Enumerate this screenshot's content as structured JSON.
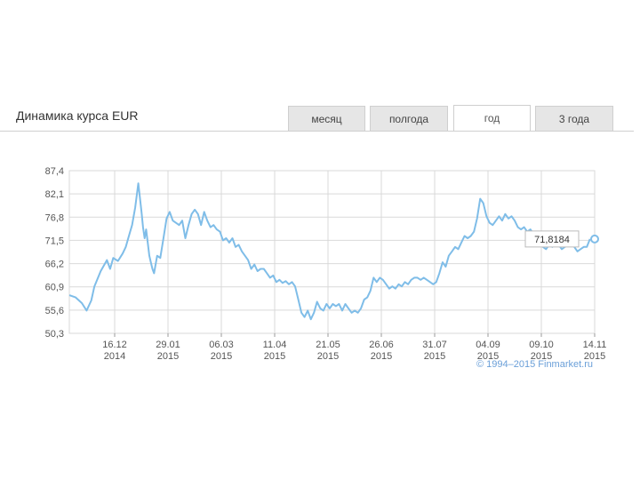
{
  "header": {
    "title": "Динамика курса EUR",
    "tabs": [
      {
        "label": "месяц",
        "active": false
      },
      {
        "label": "полгода",
        "active": false
      },
      {
        "label": "год",
        "active": true
      },
      {
        "label": "3 года",
        "active": false
      }
    ]
  },
  "copyright": "© 1994–2015 Finmarket.ru",
  "colors": {
    "line": "#7fbde8",
    "grid": "#d9d9d9",
    "axis_text": "#555555",
    "tooltip_border": "#bbbbbb"
  },
  "chart_data": {
    "type": "line",
    "title": "",
    "xlabel": "",
    "ylabel": "",
    "ylim": [
      50.3,
      87.4
    ],
    "y_ticks": [
      "87,4",
      "82,1",
      "76,8",
      "71,5",
      "66,2",
      "60,9",
      "55,6",
      "50,3"
    ],
    "x_ticks": [
      {
        "line1": "16.12",
        "line2": "2014"
      },
      {
        "line1": "29.01",
        "line2": "2015"
      },
      {
        "line1": "06.03",
        "line2": "2015"
      },
      {
        "line1": "11.04",
        "line2": "2015"
      },
      {
        "line1": "21.05",
        "line2": "2015"
      },
      {
        "line1": "26.06",
        "line2": "2015"
      },
      {
        "line1": "31.07",
        "line2": "2015"
      },
      {
        "line1": "04.09",
        "line2": "2015"
      },
      {
        "line1": "09.10",
        "line2": "2015"
      },
      {
        "line1": "14.11",
        "line2": "2015"
      }
    ],
    "grid": true,
    "x_range_days": [
      -46,
      289
    ],
    "series": [
      {
        "name": "",
        "x_days": [
          -46,
          -42,
          -38,
          -35,
          -32,
          -30,
          -26,
          -22,
          -20,
          -18,
          -15,
          -12,
          -10,
          -8,
          -6,
          -4,
          -2,
          0,
          1,
          2,
          3,
          4,
          5,
          6,
          7,
          8,
          10,
          12,
          14,
          16,
          18,
          20,
          22,
          24,
          26,
          28,
          30,
          32,
          34,
          36,
          38,
          40,
          42,
          44,
          46,
          48,
          50,
          52,
          54,
          56,
          58,
          60,
          62,
          64,
          66,
          68,
          70,
          72,
          74,
          76,
          78,
          80,
          82,
          84,
          86,
          88,
          90,
          92,
          94,
          96,
          98,
          100,
          102,
          104,
          106,
          108,
          110,
          112,
          114,
          116,
          118,
          120,
          122,
          124,
          126,
          128,
          130,
          132,
          134,
          136,
          138,
          140,
          142,
          144,
          146,
          148,
          150,
          152,
          154,
          156,
          158,
          160,
          162,
          164,
          166,
          168,
          170,
          172,
          174,
          176,
          178,
          180,
          182,
          184,
          186,
          188,
          190,
          192,
          194,
          196,
          198,
          200,
          202,
          204,
          206,
          208,
          210,
          212,
          214,
          216,
          218,
          220,
          222,
          224,
          226,
          228,
          230,
          232,
          234,
          236,
          238,
          240,
          242,
          244,
          246,
          248,
          250,
          252,
          254,
          256,
          258,
          260,
          262,
          264,
          266,
          268,
          270,
          272,
          274,
          276,
          278,
          280,
          282,
          284,
          286,
          288,
          289
        ],
        "values": [
          59.0,
          58.5,
          57.2,
          55.5,
          57.8,
          61.0,
          64.5,
          67.0,
          65.0,
          67.5,
          66.8,
          68.5,
          70.0,
          72.5,
          75.0,
          79.0,
          84.5,
          78.0,
          74.5,
          72.0,
          74.0,
          71.0,
          68.0,
          66.5,
          65.0,
          64.0,
          68.0,
          67.5,
          72.0,
          76.5,
          78.0,
          76.0,
          75.5,
          75.0,
          76.0,
          72.0,
          75.0,
          77.5,
          78.5,
          77.5,
          75.0,
          78.0,
          76.0,
          74.5,
          75.0,
          74.0,
          73.5,
          71.5,
          72.0,
          71.0,
          72.0,
          70.0,
          70.5,
          69.0,
          68.0,
          67.0,
          65.0,
          66.0,
          64.5,
          65.0,
          65.0,
          64.0,
          63.0,
          63.5,
          62.0,
          62.5,
          61.8,
          62.2,
          61.5,
          62.0,
          61.0,
          58.0,
          55.0,
          54.0,
          55.5,
          53.5,
          55.0,
          57.5,
          56.0,
          55.5,
          57.0,
          56.0,
          57.0,
          56.5,
          57.0,
          55.5,
          57.0,
          56.0,
          55.0,
          55.5,
          55.0,
          56.0,
          58.0,
          58.5,
          60.0,
          63.0,
          62.0,
          63.0,
          62.5,
          61.5,
          60.5,
          61.0,
          60.5,
          61.5,
          61.0,
          62.0,
          61.5,
          62.5,
          63.0,
          63.0,
          62.5,
          63.0,
          62.5,
          62.0,
          61.5,
          62.0,
          64.0,
          66.5,
          65.5,
          68.0,
          69.0,
          70.0,
          69.5,
          71.0,
          72.5,
          72.0,
          72.5,
          73.5,
          76.5,
          81.0,
          80.0,
          77.0,
          75.5,
          75.0,
          76.0,
          77.0,
          76.0,
          77.5,
          76.5,
          77.0,
          76.0,
          74.5,
          74.0,
          74.5,
          73.5,
          74.0,
          73.0,
          72.0,
          71.0,
          70.0,
          69.5,
          70.5,
          70.0,
          71.0,
          70.5,
          69.5,
          70.0,
          70.5,
          71.0,
          70.0,
          69.0,
          69.5,
          70.0,
          70.0,
          71.8184
        ]
      }
    ],
    "tooltip": {
      "label": "71,8184",
      "value": 71.8184
    }
  }
}
